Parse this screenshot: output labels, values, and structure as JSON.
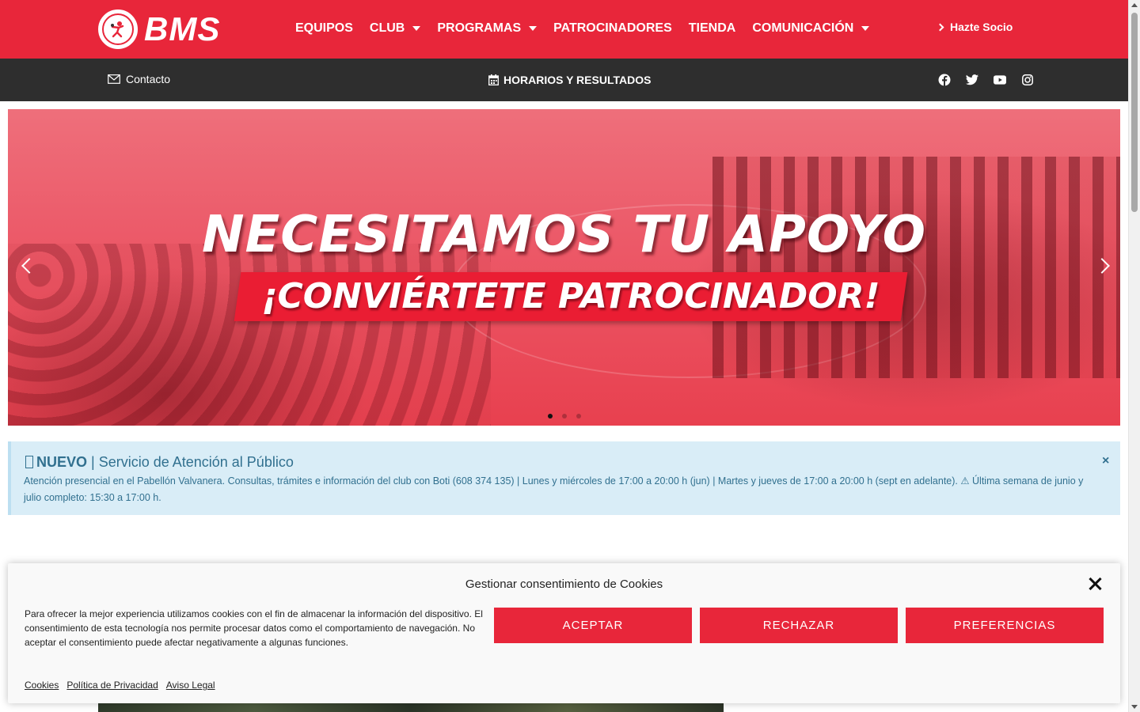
{
  "header": {
    "logo_text": "BMS",
    "nav": [
      {
        "label": "EQUIPOS",
        "dropdown": false
      },
      {
        "label": "CLUB",
        "dropdown": true
      },
      {
        "label": "PROGRAMAS",
        "dropdown": true
      },
      {
        "label": "PATROCINADORES",
        "dropdown": false
      },
      {
        "label": "TIENDA",
        "dropdown": false
      },
      {
        "label": "COMUNICACIÓN",
        "dropdown": true
      }
    ],
    "cta": "Hazte Socio"
  },
  "subbar": {
    "contact": "Contacto",
    "schedule": "HORARIOS Y RESULTADOS",
    "socials": [
      "facebook-icon",
      "twitter-icon",
      "youtube-icon",
      "instagram-icon"
    ]
  },
  "slider": {
    "headline": "NECESITAMOS TU APOYO",
    "subline": "¡CONVIÉRTETE  PATROCINADOR!",
    "slide_count": 3,
    "active_slide": 1
  },
  "notice": {
    "title_bold": "NUEVO",
    "title_rest": " | Servicio de Atención al Público",
    "body": "Atención presencial en el Pabellón Valvanera. Consultas, trámites e información del club con Boti (608 374 135) | Lunes y miércoles de 17:00 a 20:00 h (jun) | Martes y jueves de 17:00 a 20:00 h (sept en adelante). ⚠ Última semana de junio y julio completo: 15:30 a 17:00 h.",
    "close": "×"
  },
  "cookie": {
    "title": "Gestionar consentimiento de Cookies",
    "text": "Para ofrecer la mejor experiencia utilizamos cookies con el fin de almacenar la información del dispositivo. El consentimiento de esta tecnología nos permite procesar datos como el comportamiento de navegación. No aceptar el consentimiento puede afectar negativamente a algunas funciones.",
    "accept": "ACEPTAR",
    "reject": "RECHAZAR",
    "preferences": "PREFERENCIAS",
    "links": [
      "Cookies",
      "Política de Privacidad",
      "Aviso Legal"
    ]
  },
  "colors": {
    "brand_red": "#e8263a",
    "dark_bar": "#2e2e2e",
    "notice_bg": "#d9edf7",
    "notice_text": "#31708f"
  }
}
